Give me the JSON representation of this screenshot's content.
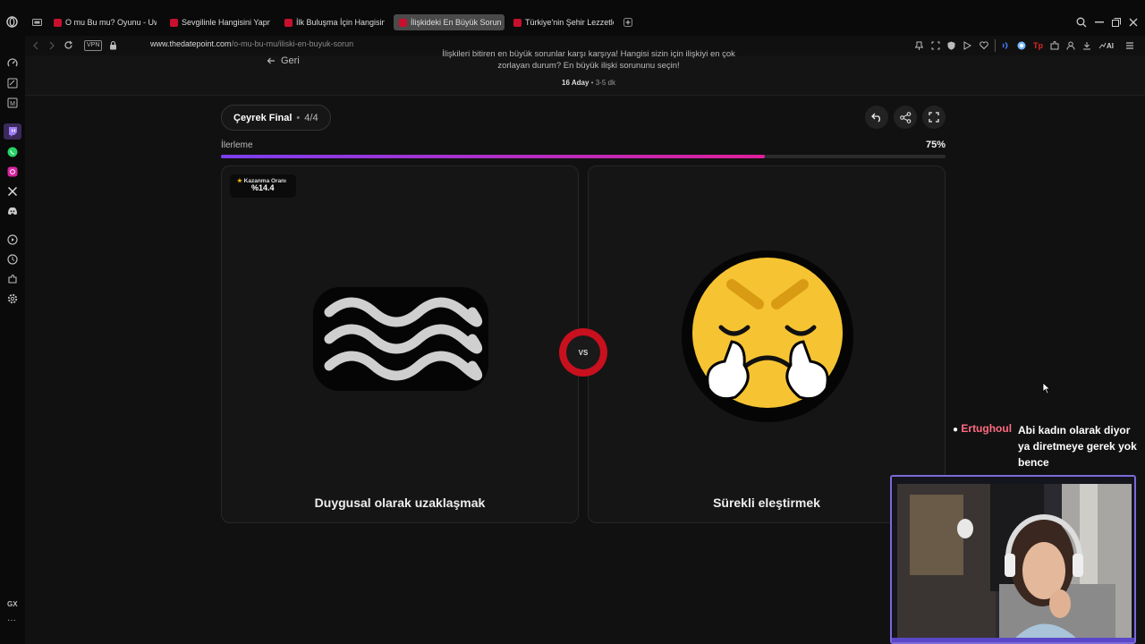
{
  "tabs": [
    {
      "label": "O mu Bu mu? Oyunu - Uw",
      "active": false
    },
    {
      "label": "Sevgilinle Hangisini Yapm",
      "active": false
    },
    {
      "label": "İlk Buluşma İçin Hangisini",
      "active": false
    },
    {
      "label": "İlişkideki En Büyük Sorun",
      "active": true
    },
    {
      "label": "Türkiye'nin Şehir Lezzetle",
      "active": false
    }
  ],
  "address": {
    "vpn": "VPN",
    "domain": "www.thedatepoint.com",
    "path": "/o-mu-bu-mu/iliski-en-buyuk-sorun"
  },
  "header": {
    "back_label": "Geri",
    "description": "İlişkileri bitiren en büyük sorunlar karşı karşıya! Hangisi sizin için ilişkiyi en çok zorlayan durum? En büyük ilişki sorununu seçin!",
    "candidates": "16 Aday",
    "duration": "3-5 dk"
  },
  "round": {
    "label": "Çeyrek Final",
    "progress_text": "4/4"
  },
  "progress": {
    "label": "İlerleme",
    "percent_text": "75%",
    "value": 0.75,
    "color_start": "#7b3ff2",
    "color_end": "#e0209a"
  },
  "left_card": {
    "badge_label": "Kazanma Oranı",
    "badge_value": "%14.4",
    "title": "Duygusal olarak uzaklaşmak",
    "icon": "waves-icon"
  },
  "right_card": {
    "title": "Sürekli eleştirmek",
    "icon": "angry-face-steam-icon"
  },
  "vs_label": "VS",
  "chat": {
    "username": "Ertughoul",
    "message": "Abi kadın olarak diyor ya diretmeye gerek yok bence",
    "username_color": "#ff6b81"
  },
  "sidebar_bottom": "GX",
  "sidebar_more": "···"
}
